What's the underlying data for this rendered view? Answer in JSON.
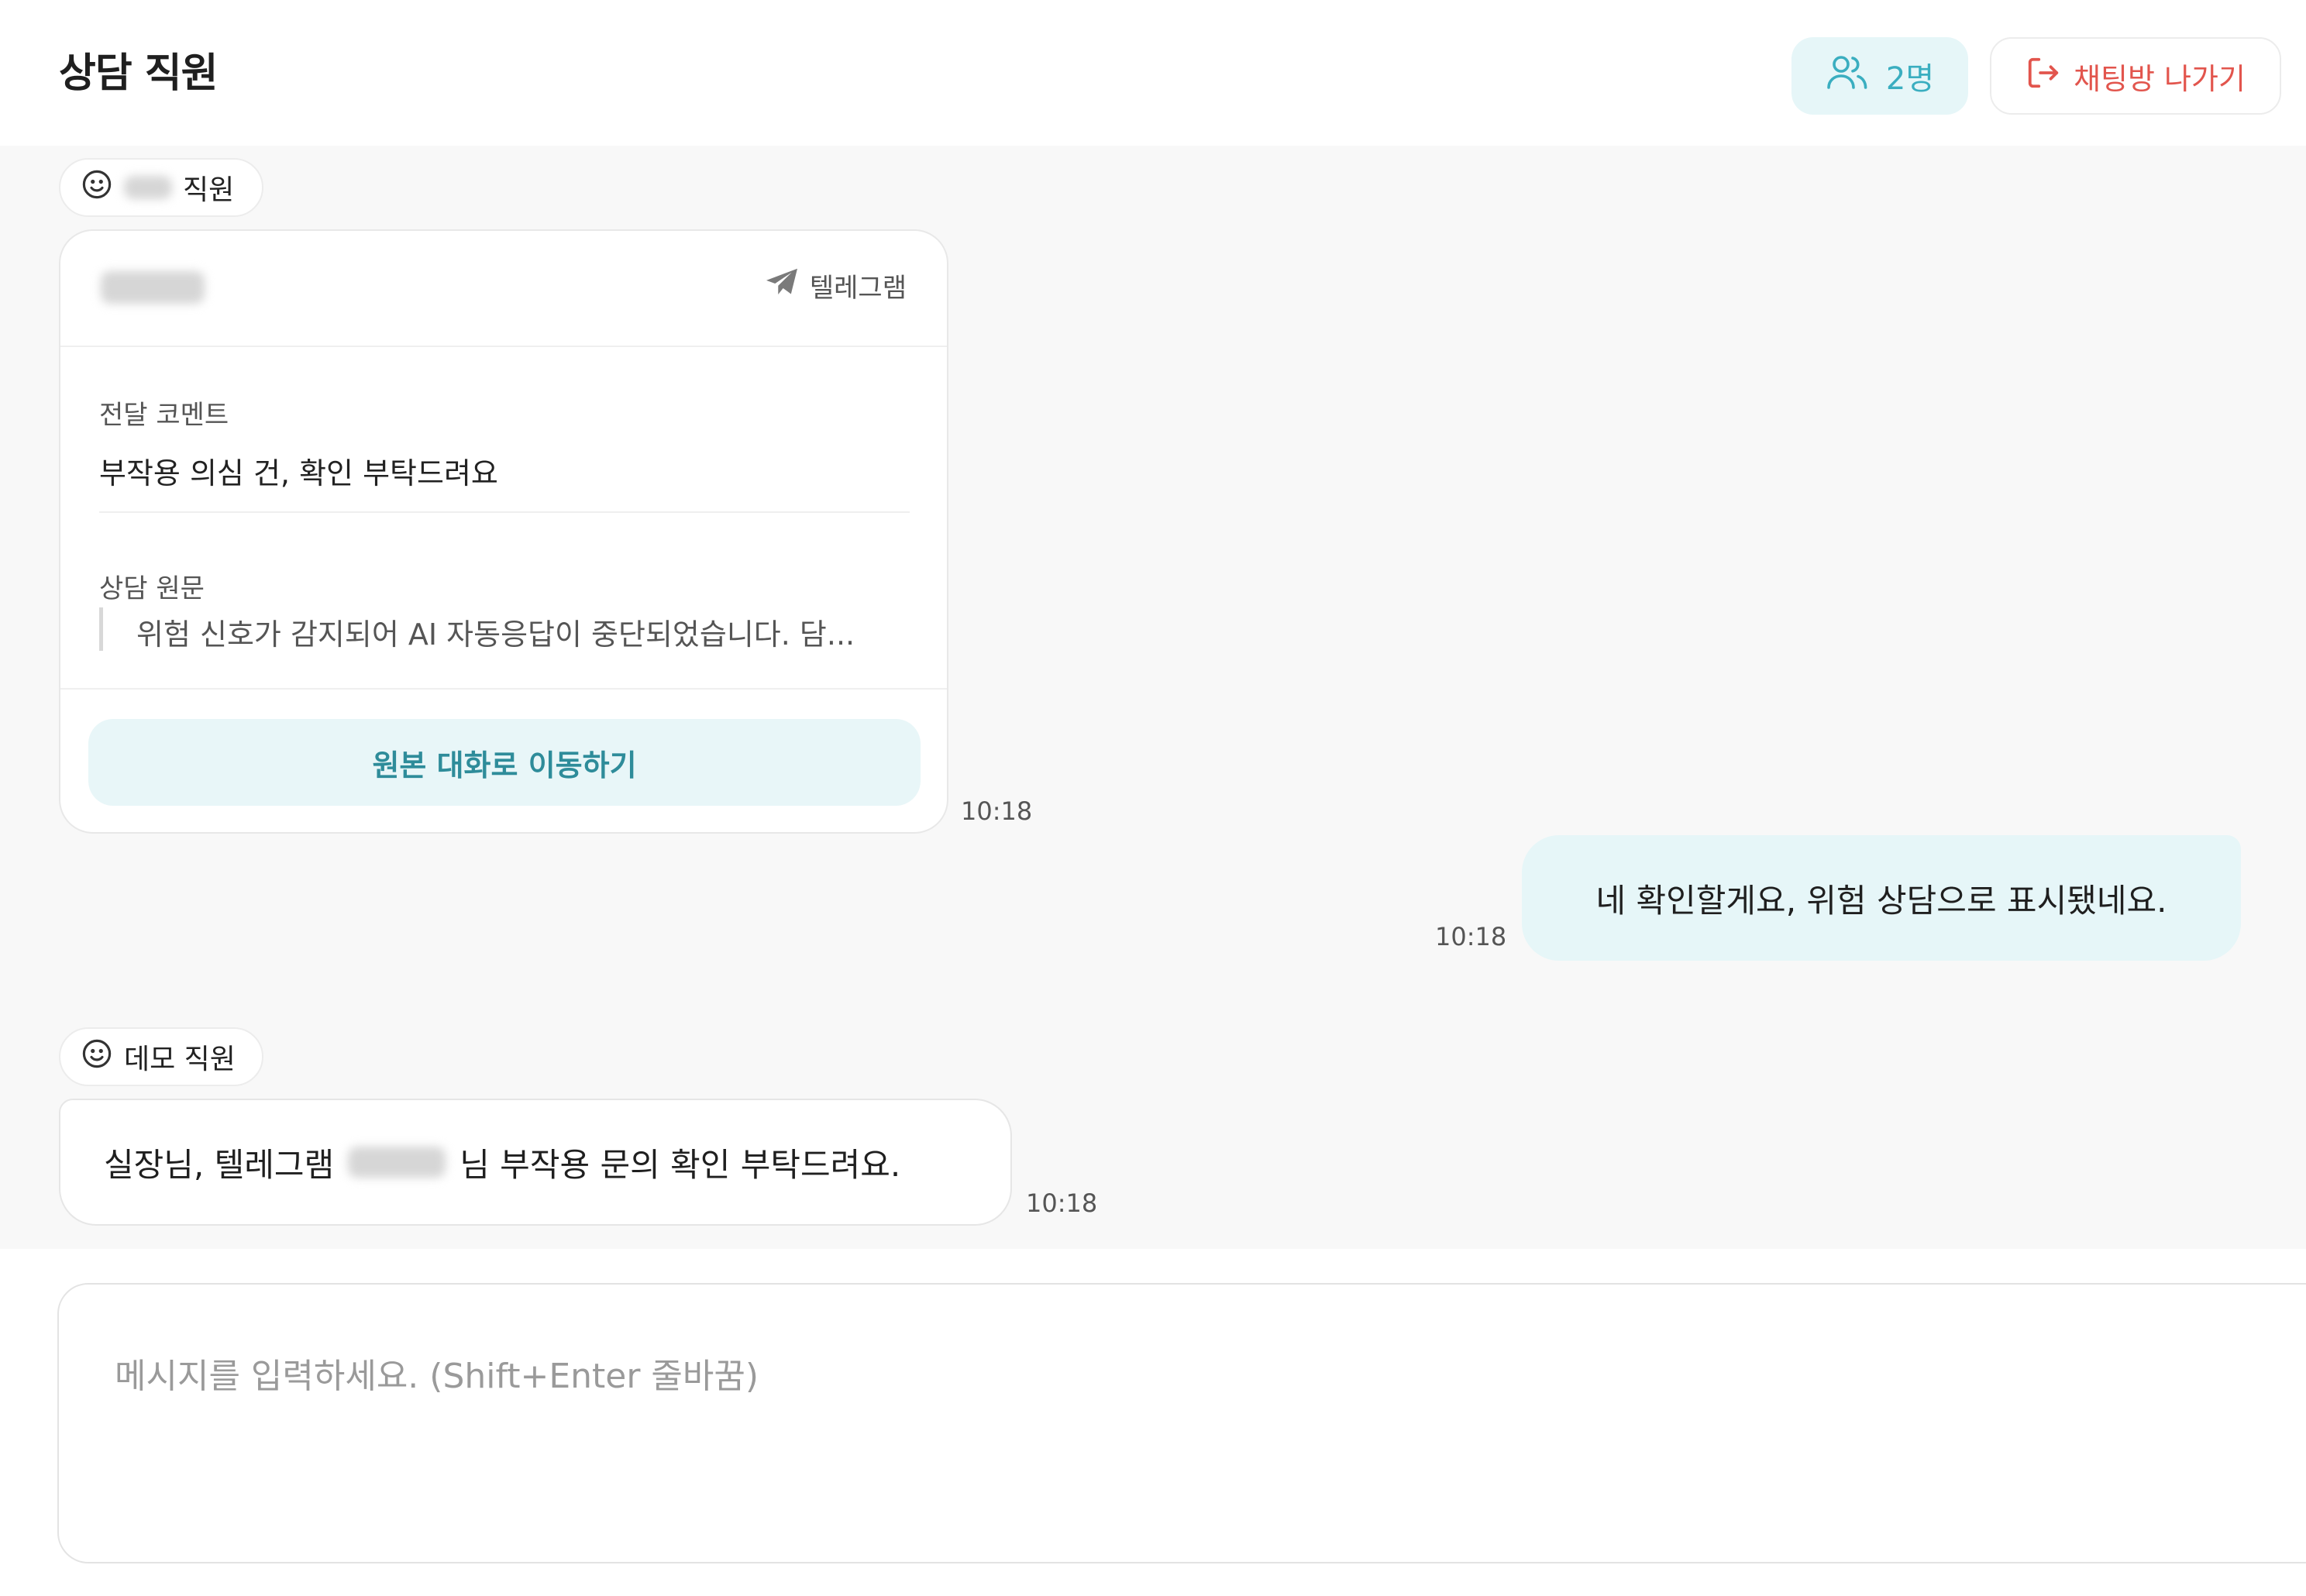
{
  "header": {
    "title": "상담 직원",
    "members_label": "2명",
    "leave_label": "채팅방 나가기"
  },
  "messages": {
    "card_message": {
      "sender_suffix": "직원",
      "channel": "텔레그램",
      "comment_label": "전달 코멘트",
      "comment_text": "부작용 의심 건, 확인 부탁드려요",
      "original_label": "상담 원문",
      "original_text": "위험 신호가 감지되어 AI 자동응답이 중단되었습니다. 담...",
      "goto_label": "원본 대화로 이동하기",
      "time": "10:18"
    },
    "reply": {
      "text": "네 확인할게요, 위험 상담으로 표시됐네요.",
      "time": "10:18"
    },
    "demo_message": {
      "sender": "데모 직원",
      "text_before": "실장님, 텔레그램",
      "text_after": "님 부작용 문의 확인 부탁드려요.",
      "time": "10:18"
    }
  },
  "composer": {
    "placeholder": "메시지를 입력하세요. (Shift+Enter 줄바꿈)"
  },
  "icons": {
    "members": "users-icon",
    "leave": "logout-icon",
    "sender": "smiley-icon",
    "channel": "telegram-send-icon"
  },
  "colors": {
    "accent": "#3aaec0",
    "accent_bg": "#e6f6f8",
    "danger": "#e2554d",
    "chat_bg": "#f8f8f8"
  }
}
